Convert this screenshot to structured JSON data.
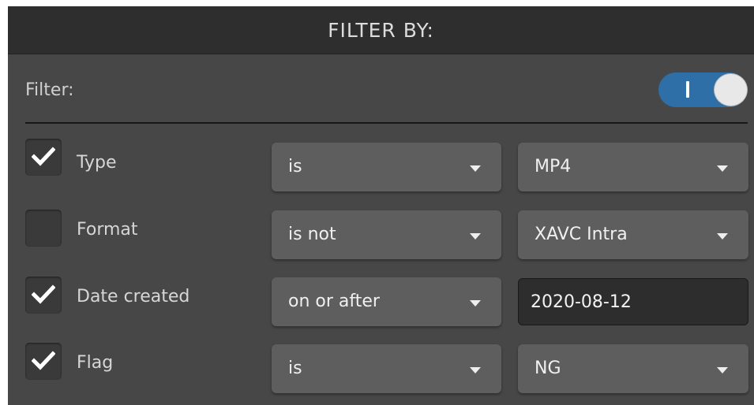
{
  "header": {
    "title": "FILTER BY:"
  },
  "filter": {
    "label": "Filter:",
    "toggle_on_glyph": "I",
    "enabled": true
  },
  "rows": [
    {
      "label": "Type",
      "checked": true,
      "operator": "is",
      "value": "MP4",
      "value_kind": "dropdown"
    },
    {
      "label": "Format",
      "checked": false,
      "operator": "is not",
      "value": "XAVC Intra",
      "value_kind": "dropdown"
    },
    {
      "label": "Date created",
      "checked": true,
      "operator": "on or after",
      "value": "2020-08-12",
      "value_kind": "text-input"
    },
    {
      "label": "Flag",
      "checked": true,
      "operator": "is",
      "value": "NG",
      "value_kind": "dropdown"
    }
  ],
  "icons": {
    "checkmark": "check-icon",
    "dropdown": "caret-down-icon"
  },
  "colors": {
    "panel_bg": "#474747",
    "header_bg": "#2e2e2e",
    "toggle_on": "#2e6fa8",
    "control_bg": "#5e5e5e",
    "input_bg": "#2d2d2d"
  }
}
